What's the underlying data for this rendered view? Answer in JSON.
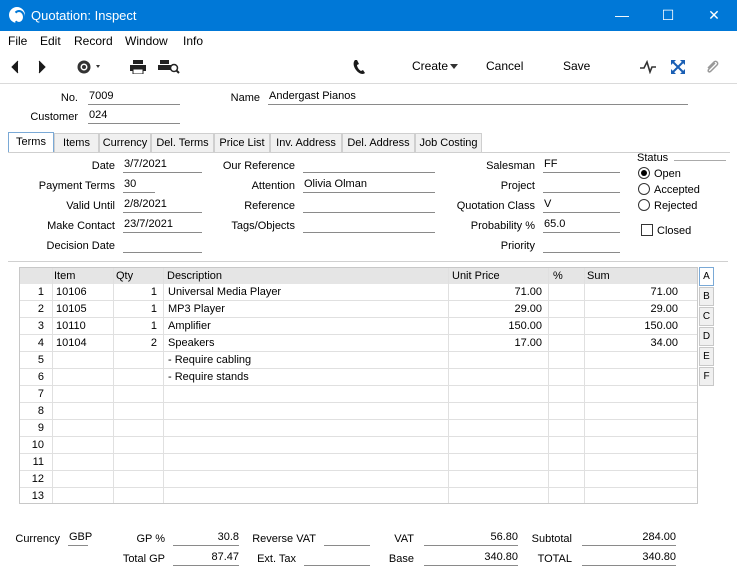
{
  "window": {
    "title": "Quotation: Inspect",
    "minimize": "—",
    "maximize": "☐",
    "close": "✕"
  },
  "menu": [
    "File",
    "Edit",
    "Record",
    "Window",
    "Info"
  ],
  "toolbar": {
    "create": "Create",
    "cancel": "Cancel",
    "save": "Save"
  },
  "header": {
    "no_label": "No.",
    "no": "7009",
    "customer_label": "Customer",
    "customer": "024",
    "name_label": "Name",
    "name": "Andergast Pianos"
  },
  "tabs": [
    "Terms",
    "Items",
    "Currency",
    "Del. Terms",
    "Price List",
    "Inv. Address",
    "Del. Address",
    "Job Costing"
  ],
  "terms": {
    "date_label": "Date",
    "date": "3/7/2021",
    "payment_terms_label": "Payment Terms",
    "payment_terms": "30",
    "valid_until_label": "Valid Until",
    "valid_until": "2/8/2021",
    "make_contact_label": "Make Contact",
    "make_contact": "23/7/2021",
    "decision_date_label": "Decision Date",
    "decision_date": "",
    "our_reference_label": "Our Reference",
    "our_reference": "",
    "attention_label": "Attention",
    "attention": "Olivia Olman",
    "reference_label": "Reference",
    "reference": "",
    "tags_label": "Tags/Objects",
    "tags": "",
    "salesman_label": "Salesman",
    "salesman": "FF",
    "project_label": "Project",
    "project": "",
    "quotation_class_label": "Quotation Class",
    "quotation_class": "V",
    "probability_label": "Probability %",
    "probability": "65.0",
    "priority_label": "Priority",
    "priority": ""
  },
  "status": {
    "label": "Status",
    "options": [
      "Open",
      "Accepted",
      "Rejected"
    ],
    "selected": "Open",
    "closed_label": "Closed"
  },
  "grid": {
    "headers": [
      "Item",
      "Qty",
      "Description",
      "Unit Price",
      "%",
      "Sum"
    ],
    "rows": [
      {
        "n": "1",
        "item": "10106",
        "qty": "1",
        "desc": "Universal Media Player",
        "price": "71.00",
        "pct": "",
        "sum": "71.00"
      },
      {
        "n": "2",
        "item": "10105",
        "qty": "1",
        "desc": "MP3 Player",
        "price": "29.00",
        "pct": "",
        "sum": "29.00"
      },
      {
        "n": "3",
        "item": "10110",
        "qty": "1",
        "desc": "Amplifier",
        "price": "150.00",
        "pct": "",
        "sum": "150.00"
      },
      {
        "n": "4",
        "item": "10104",
        "qty": "2",
        "desc": "Speakers",
        "price": "17.00",
        "pct": "",
        "sum": "34.00"
      },
      {
        "n": "5",
        "item": "",
        "qty": "",
        "desc": "- Require cabling",
        "price": "",
        "pct": "",
        "sum": ""
      },
      {
        "n": "6",
        "item": "",
        "qty": "",
        "desc": "- Require stands",
        "price": "",
        "pct": "",
        "sum": ""
      },
      {
        "n": "7",
        "item": "",
        "qty": "",
        "desc": "",
        "price": "",
        "pct": "",
        "sum": ""
      },
      {
        "n": "8",
        "item": "",
        "qty": "",
        "desc": "",
        "price": "",
        "pct": "",
        "sum": ""
      },
      {
        "n": "9",
        "item": "",
        "qty": "",
        "desc": "",
        "price": "",
        "pct": "",
        "sum": ""
      },
      {
        "n": "10",
        "item": "",
        "qty": "",
        "desc": "",
        "price": "",
        "pct": "",
        "sum": ""
      },
      {
        "n": "11",
        "item": "",
        "qty": "",
        "desc": "",
        "price": "",
        "pct": "",
        "sum": ""
      },
      {
        "n": "12",
        "item": "",
        "qty": "",
        "desc": "",
        "price": "",
        "pct": "",
        "sum": ""
      },
      {
        "n": "13",
        "item": "",
        "qty": "",
        "desc": "",
        "price": "",
        "pct": "",
        "sum": ""
      }
    ],
    "side_tabs": [
      "A",
      "B",
      "C",
      "D",
      "E",
      "F"
    ]
  },
  "footer": {
    "currency_label": "Currency",
    "currency": "GBP",
    "gp_pct_label": "GP %",
    "gp_pct": "30.8",
    "total_gp_label": "Total GP",
    "total_gp": "87.47",
    "reverse_vat_label": "Reverse VAT",
    "reverse_vat": "",
    "ext_tax_label": "Ext. Tax",
    "ext_tax": "",
    "vat_label": "VAT",
    "vat": "56.80",
    "base_label": "Base",
    "base": "340.80",
    "subtotal_label": "Subtotal",
    "subtotal": "284.00",
    "total_label": "TOTAL",
    "total": "340.80"
  },
  "colors": {
    "titlebar": "#0078d7",
    "accent": "#1a5fb4"
  }
}
